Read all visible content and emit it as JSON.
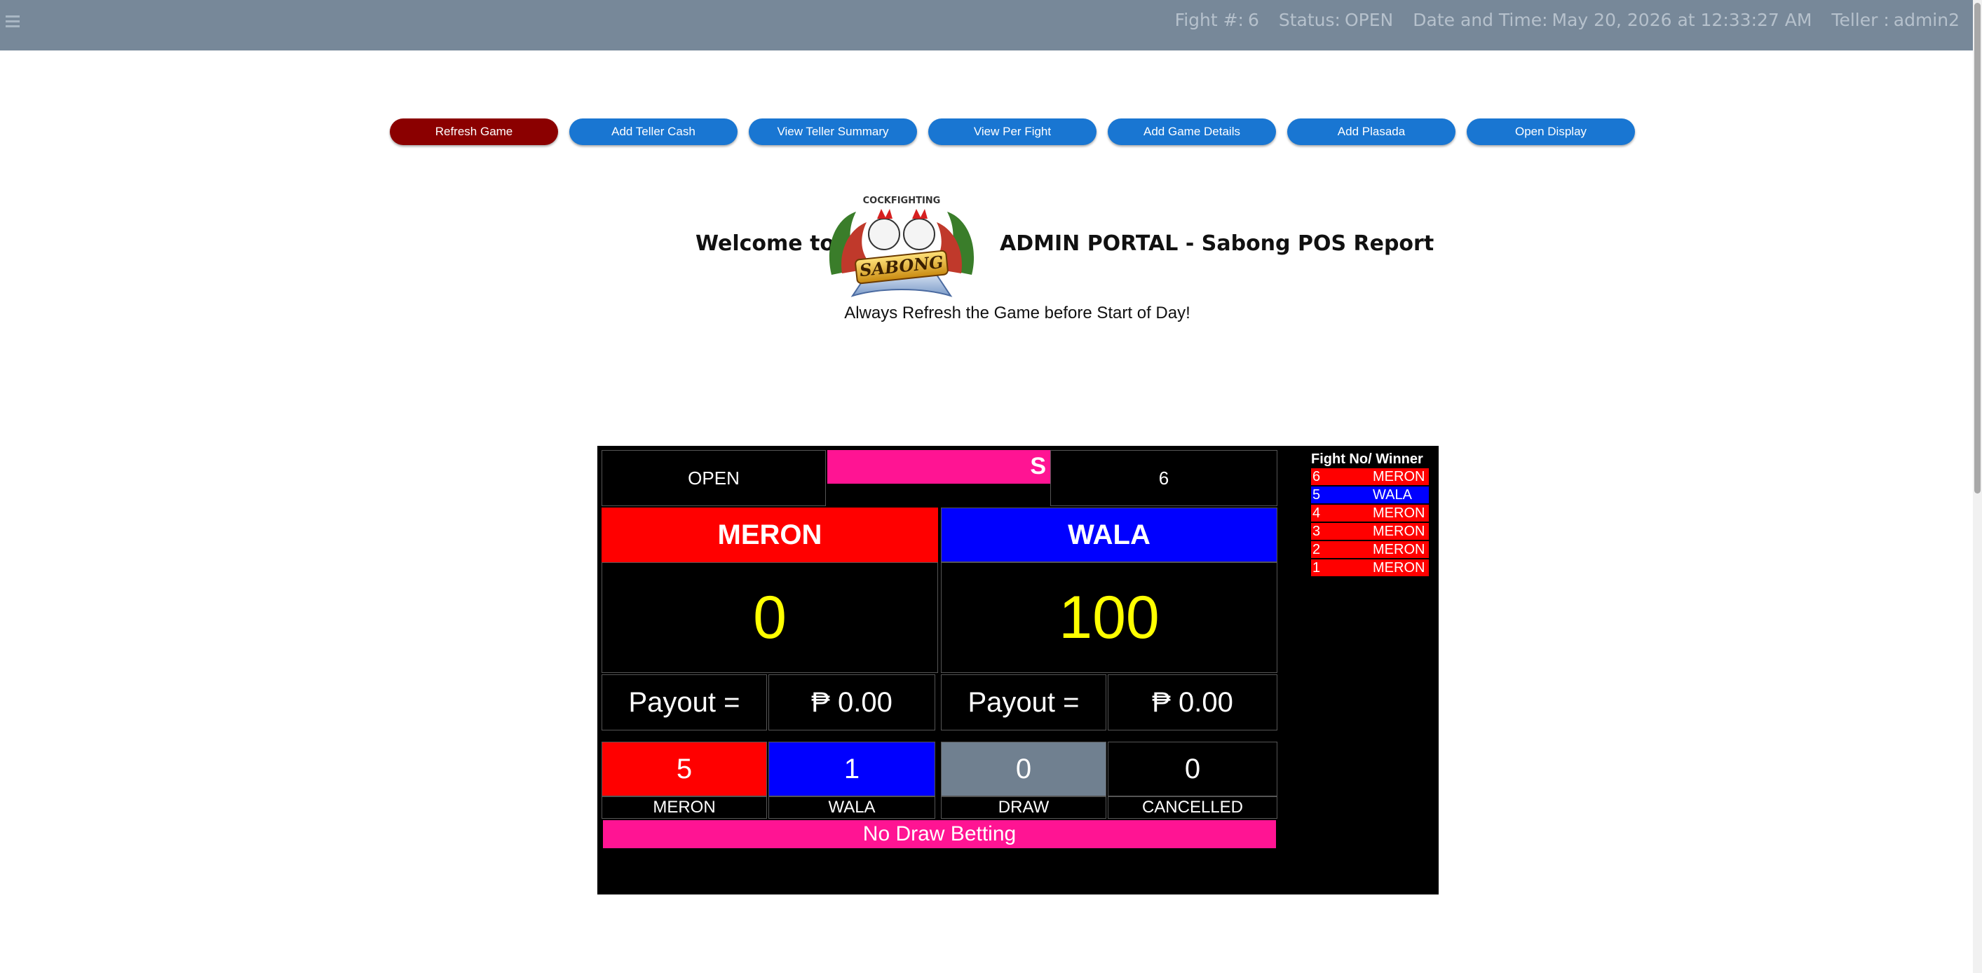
{
  "topbar": {
    "fight_label": "Fight #:",
    "fight_no": "6",
    "status_label": "Status:",
    "status": "OPEN",
    "datetime_label": "Date and Time:",
    "datetime": "May 20, 2026 at 12:33:27 AM",
    "teller_label": "Teller :",
    "teller": "admin2"
  },
  "buttons": {
    "refresh": "Refresh Game",
    "add_teller_cash": "Add Teller Cash",
    "view_teller_summary": "View Teller Summary",
    "view_per_fight": "View Per Fight",
    "add_game_details": "Add Game Details",
    "add_plasada": "Add Plasada",
    "open_display": "Open Display"
  },
  "welcome": {
    "prefix": "Welcome to",
    "title": "ADMIN PORTAL - Sabong POS Report",
    "note": "Always Refresh the Game before Start of Day!",
    "logo_top_text": "COCKFIGHTING",
    "logo_main_text": "SABONG"
  },
  "board": {
    "status": "OPEN",
    "ticker": "S",
    "fight_no": "6",
    "meron_label": "MERON",
    "wala_label": "WALA",
    "meron_bet": "0",
    "wala_bet": "100",
    "payout_label": "Payout =",
    "meron_payout": "₱ 0.00",
    "wala_payout": "₱ 0.00",
    "counts": {
      "meron": "5",
      "wala": "1",
      "draw": "0",
      "cancelled": "0"
    },
    "count_labels": {
      "meron": "MERON",
      "wala": "WALA",
      "draw": "DRAW",
      "cancelled": "CANCELLED"
    },
    "no_draw": "No Draw Betting"
  },
  "history": {
    "title": "Fight No/ Winner",
    "rows": [
      {
        "no": "6",
        "winner": "MERON"
      },
      {
        "no": "5",
        "winner": "WALA"
      },
      {
        "no": "4",
        "winner": "MERON"
      },
      {
        "no": "3",
        "winner": "MERON"
      },
      {
        "no": "2",
        "winner": "MERON"
      },
      {
        "no": "1",
        "winner": "MERON"
      }
    ]
  },
  "colors": {
    "topbar": "#778899",
    "primary_button": "#1976d2",
    "danger_button": "#8b0000",
    "meron": "#ff0000",
    "wala": "#0000ff",
    "draw": "#708090",
    "accent_pink": "#ff1493",
    "bet_amount": "#ffff00"
  }
}
